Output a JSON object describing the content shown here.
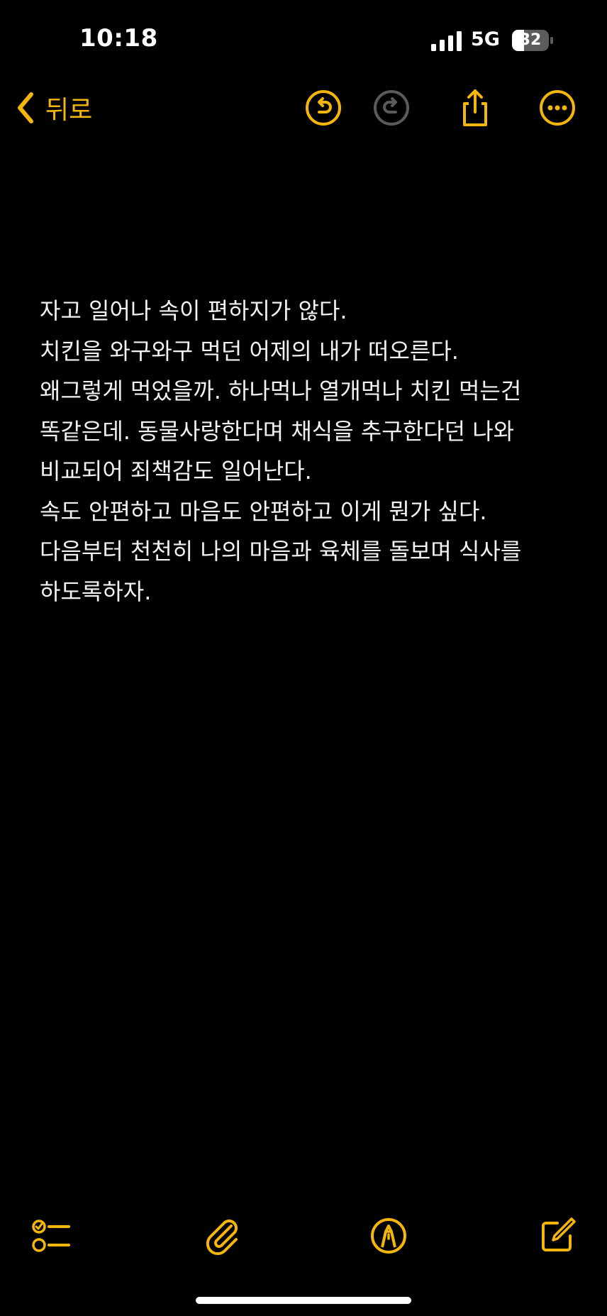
{
  "status_bar": {
    "time": "10:18",
    "network": "5G",
    "battery": "32"
  },
  "nav": {
    "back_label": "뒤로",
    "icons": [
      "undo-icon",
      "redo-icon",
      "share-icon",
      "more-icon"
    ]
  },
  "note": {
    "lines": [
      "자고 일어나 속이 편하지가 않다.",
      "치킨을 와구와구 먹던 어제의 내가 떠오른다.",
      "왜그렇게 먹었을까. 하나먹나 열개먹나 치킨 먹는건",
      "똑같은데. 동물사랑한다며 채식을 추구한다던 나와",
      "비교되어 죄책감도 일어난다.",
      "속도 안편하고 마음도 안편하고 이게 뭔가 싶다.",
      "다음부터 천천히 나의 마음과 육체를 돌보며 식사를",
      "하도록하자."
    ]
  },
  "toolbar": {
    "icons": [
      "checklist-icon",
      "paperclip-icon",
      "markup-pen-icon",
      "compose-icon"
    ]
  },
  "colors": {
    "accent": "#f5b60b",
    "background": "#000000",
    "text": "#f2f2f2",
    "disabled": "#5a5a5a"
  }
}
